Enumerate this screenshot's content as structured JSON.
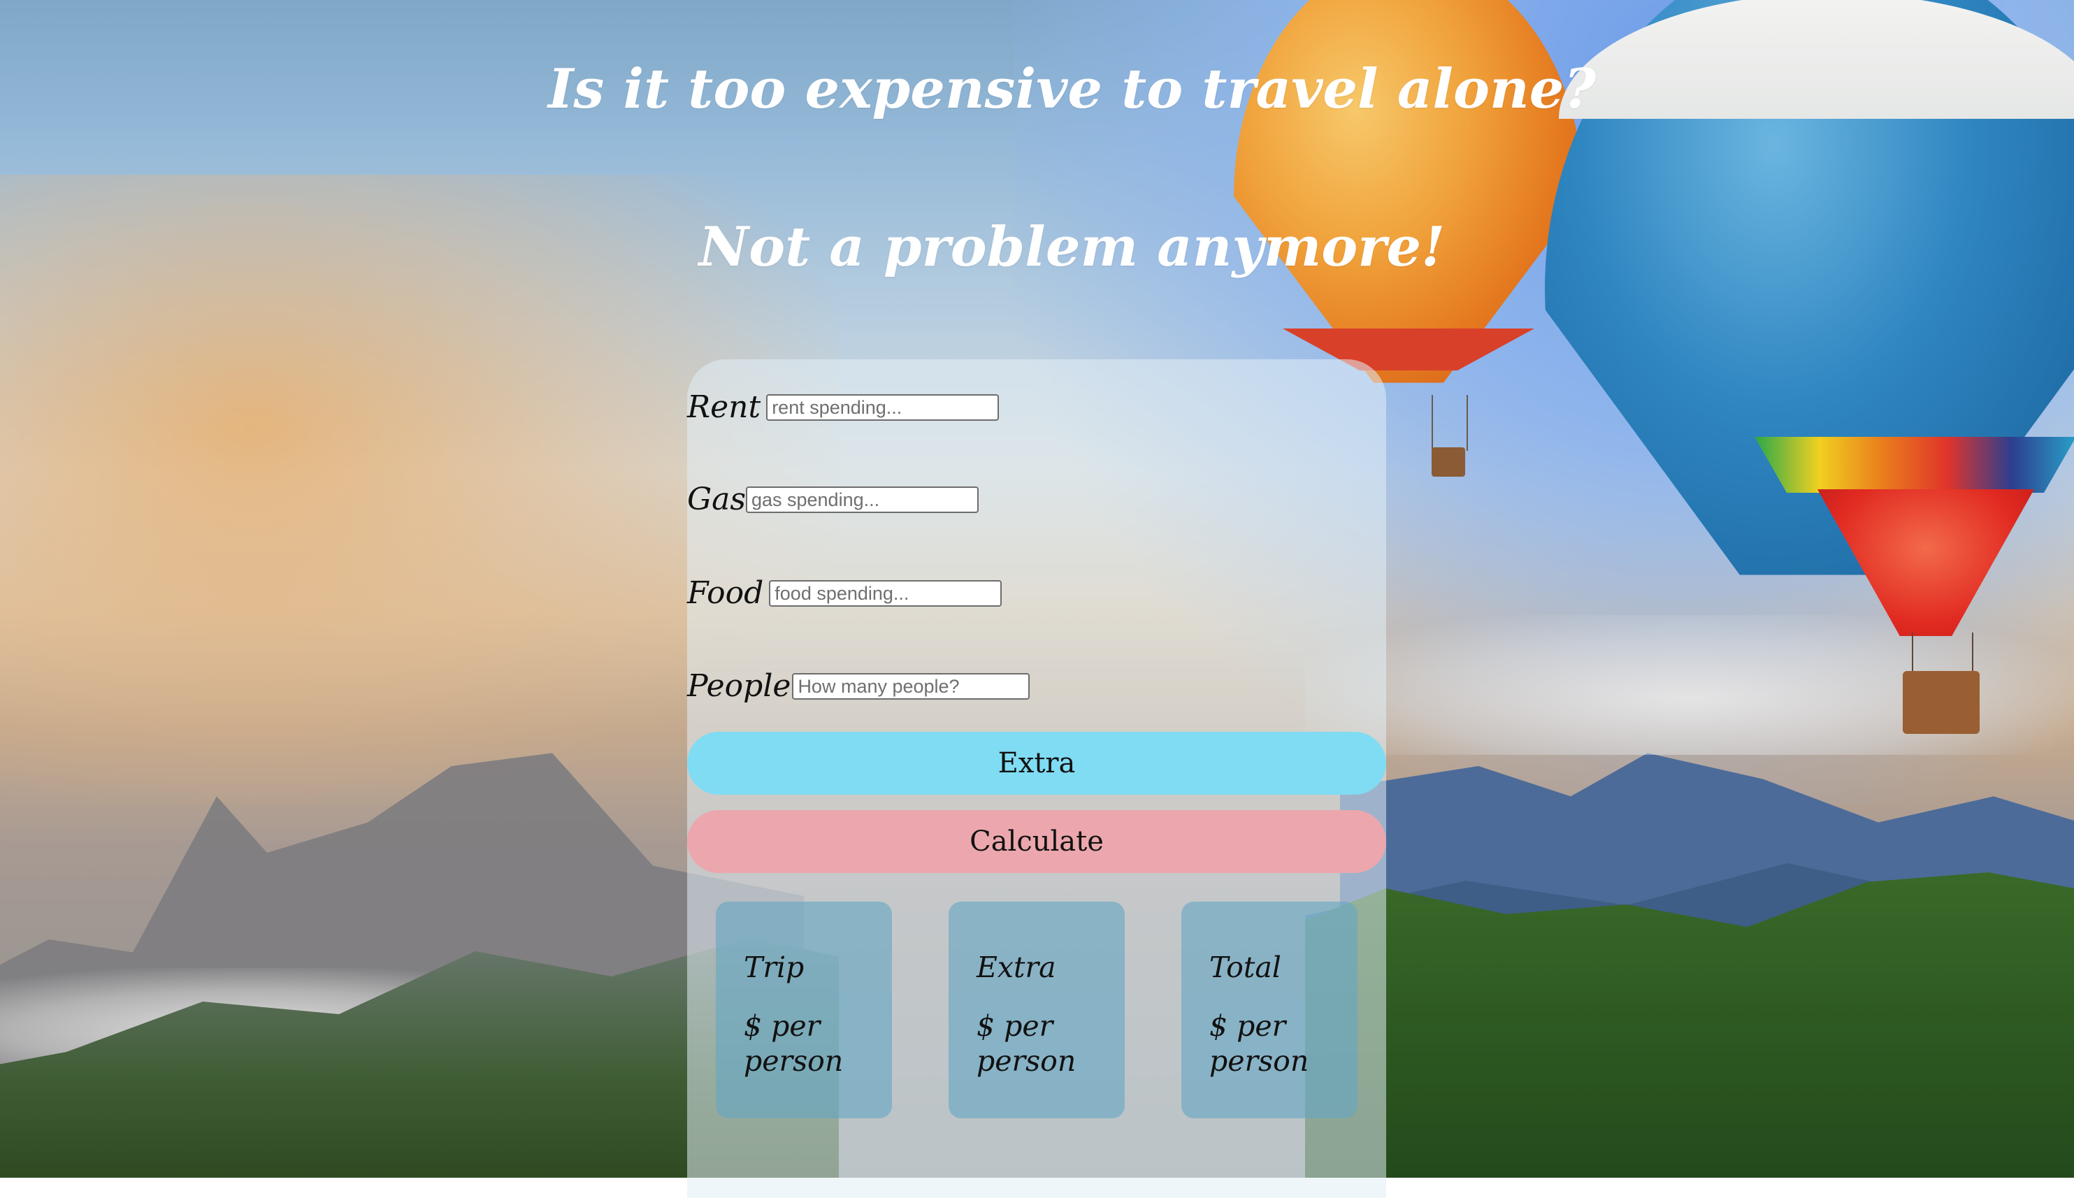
{
  "headings": {
    "title": "Is it too expensive to travel alone?",
    "subtitle": "Not a problem anymore!"
  },
  "form": {
    "rent": {
      "label": "Rent",
      "value": "",
      "placeholder": "rent spending..."
    },
    "gas": {
      "label": "Gas",
      "value": "",
      "placeholder": "gas spending..."
    },
    "food": {
      "label": "Food",
      "value": "",
      "placeholder": "food spending..."
    },
    "people": {
      "label": "People",
      "value": "",
      "placeholder": "How many people?"
    }
  },
  "buttons": {
    "extra": "Extra",
    "calculate": "Calculate"
  },
  "results": [
    {
      "title": "Trip",
      "value": "$ per person"
    },
    {
      "title": "Extra",
      "value": "$ per person"
    },
    {
      "title": "Total",
      "value": "$ per person"
    }
  ],
  "colors": {
    "extra_button": "#80dcf3",
    "calculate_button": "#eba7ad",
    "result_card": "#65a7c4",
    "heading_text": "#ffffff"
  }
}
